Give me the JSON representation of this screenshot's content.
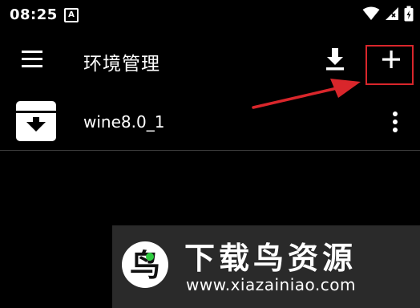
{
  "status_bar": {
    "time": "08:25",
    "notification_icon_text": "A",
    "icons": [
      "wifi-icon",
      "signal-icon",
      "battery-icon"
    ]
  },
  "app_bar": {
    "title": "环境管理",
    "icons": [
      "menu-icon",
      "download-icon",
      "add-icon"
    ]
  },
  "list": {
    "items": [
      {
        "label": "wine8.0_1",
        "icon": "archive-download-icon",
        "action_icon": "more-vert-icon"
      }
    ]
  },
  "annotation": {
    "color": "#d9262b"
  },
  "watermark": {
    "logo_letter": "鸟",
    "brand": "下载鸟资源",
    "url": "www.xiazainiao.com"
  }
}
